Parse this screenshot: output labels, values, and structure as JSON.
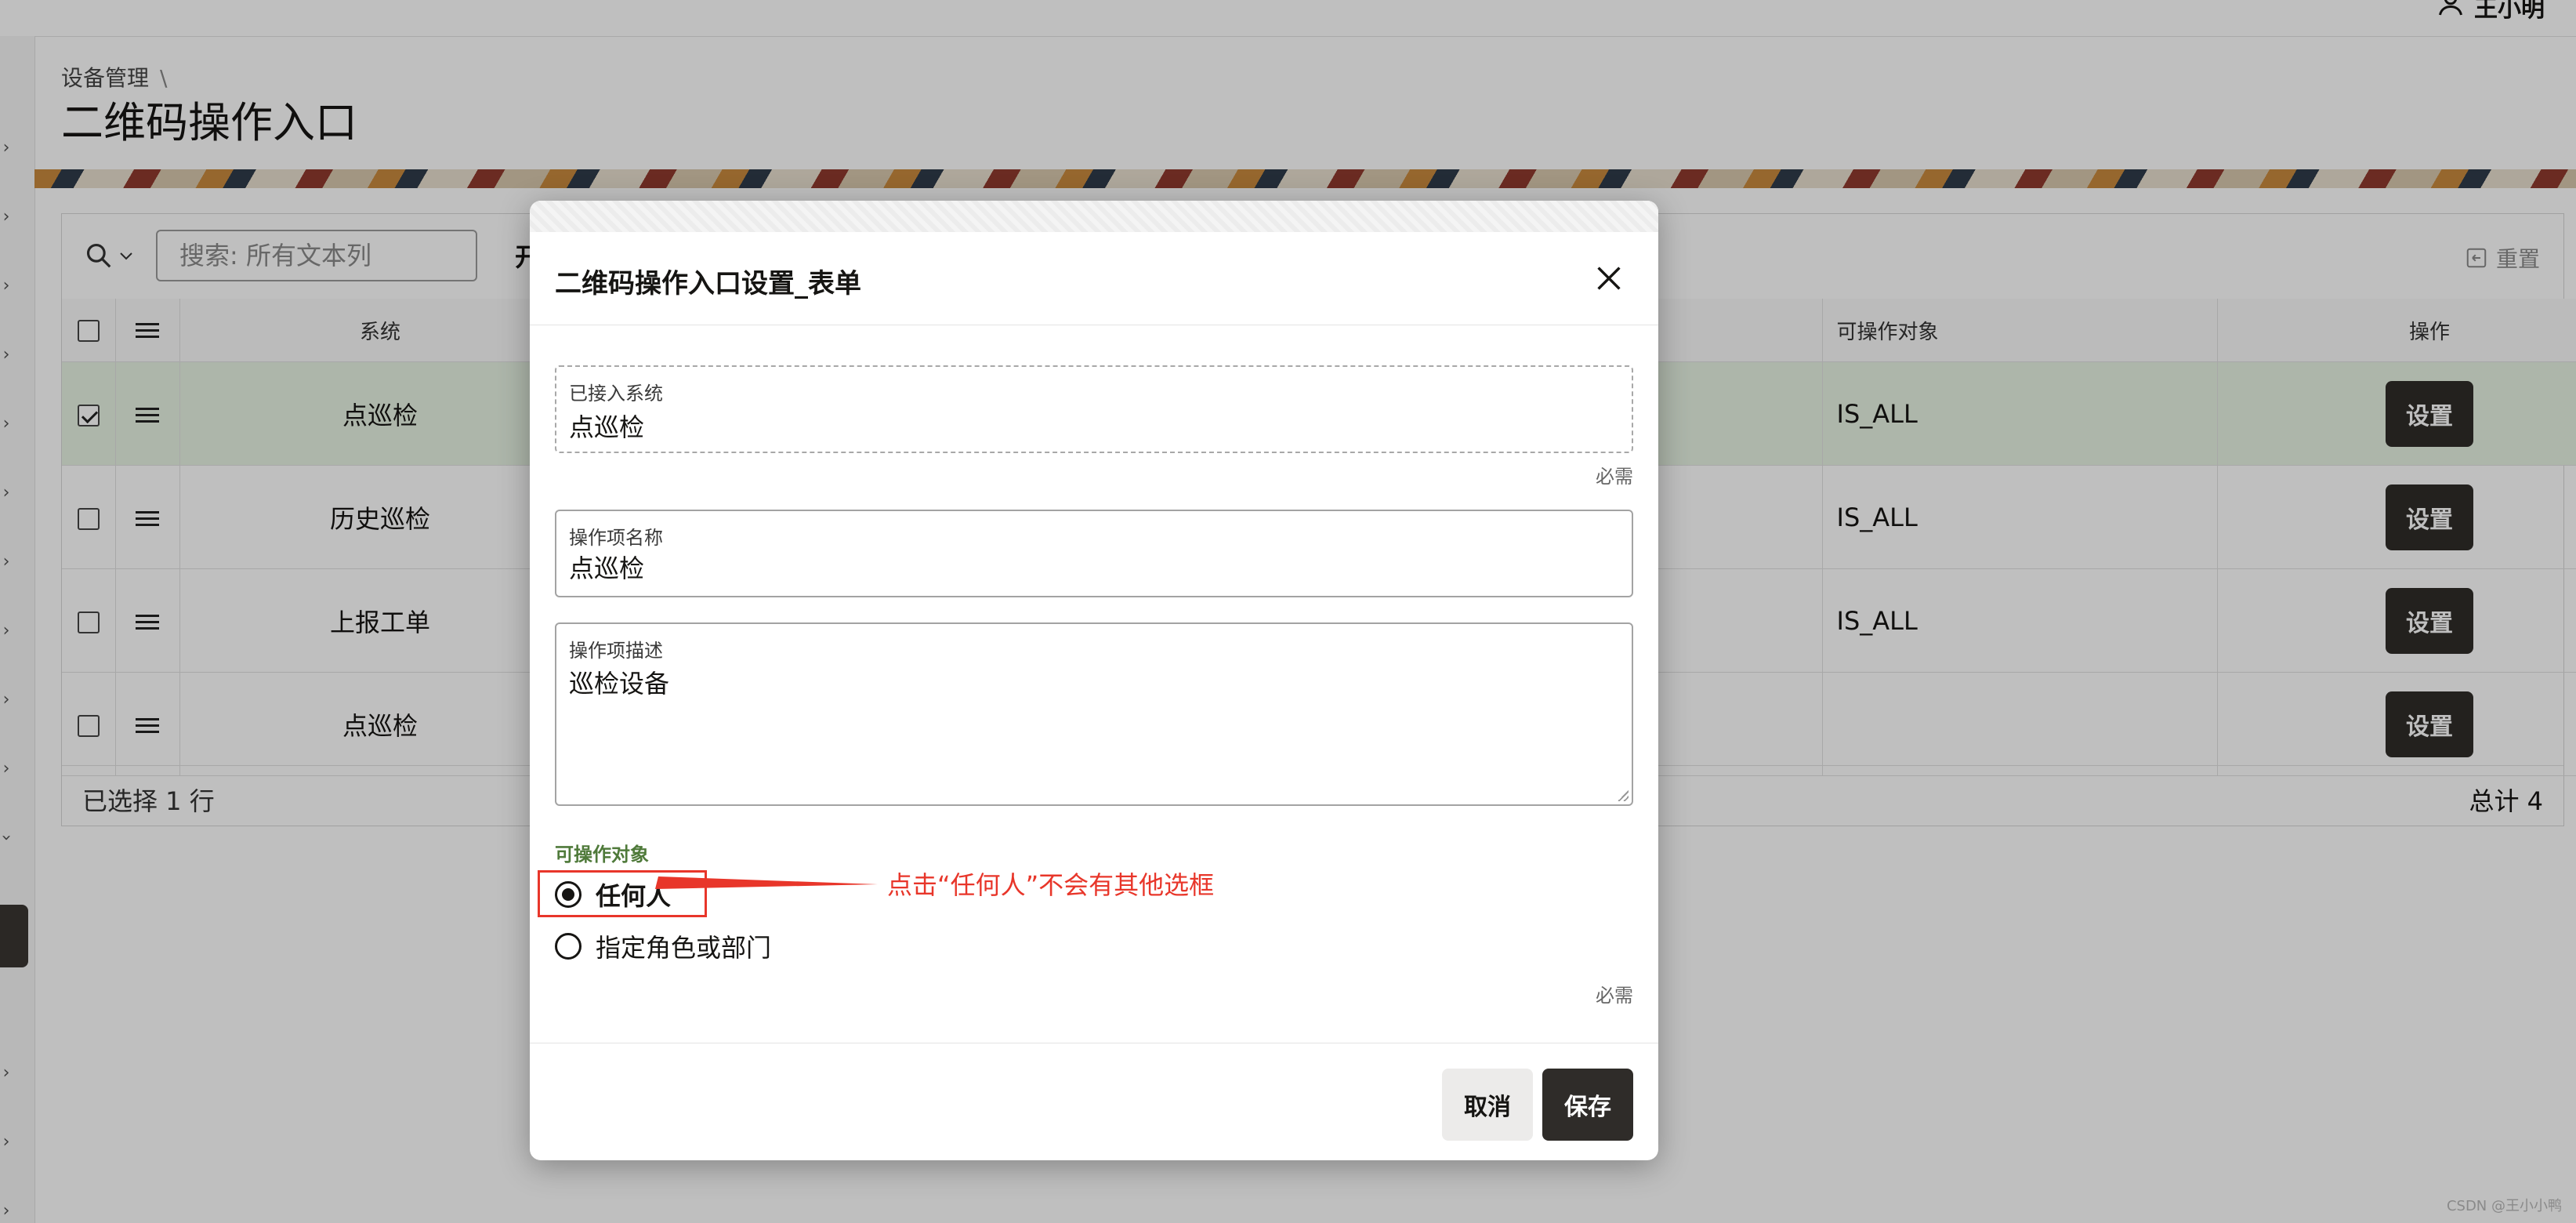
{
  "app": {
    "breadcrumb": "设备管理",
    "breadcrumb_sep": "\\",
    "page_title": "二维码操作入口",
    "user_label": "王小明"
  },
  "report": {
    "search_placeholder": "搜索: 所有文本列",
    "toolbar_extra": "开",
    "reset_label": "重置",
    "columns": {
      "system": "系统",
      "target": "可操作对象",
      "action": "操作"
    },
    "rows": [
      {
        "system": "点巡检",
        "target": "IS_ALL",
        "action": "设置",
        "selected": true
      },
      {
        "system": "历史巡检",
        "target": "IS_ALL",
        "action": "设置",
        "selected": false
      },
      {
        "system": "上报工单",
        "target": "IS_ALL",
        "action": "设置",
        "selected": false
      },
      {
        "system": "点巡检",
        "target": "",
        "action": "设置",
        "selected": false
      }
    ],
    "selected_text": "已选择 1 行",
    "total_text": "总计 4"
  },
  "dialog": {
    "title": "二维码操作入口设置_表单",
    "system_label": "已接入系统",
    "system_value": "点巡检",
    "required_text": "必需",
    "name_label": "操作项名称",
    "name_value": "点巡检",
    "desc_label": "操作项描述",
    "desc_value": "巡检设备",
    "target_label": "可操作对象",
    "options": [
      {
        "label": "任何人",
        "checked": true
      },
      {
        "label": "指定角色或部门",
        "checked": false
      }
    ],
    "cancel_label": "取消",
    "save_label": "保存"
  },
  "annotation": {
    "text": "点击“任何人”不会有其他选框",
    "color": "#e8362a"
  },
  "watermark": "CSDN @王小小鸭",
  "colors": {
    "dark_button": "#2f2c29",
    "selected_row": "#e7f3e3",
    "group_label": "#4f7a3a"
  }
}
